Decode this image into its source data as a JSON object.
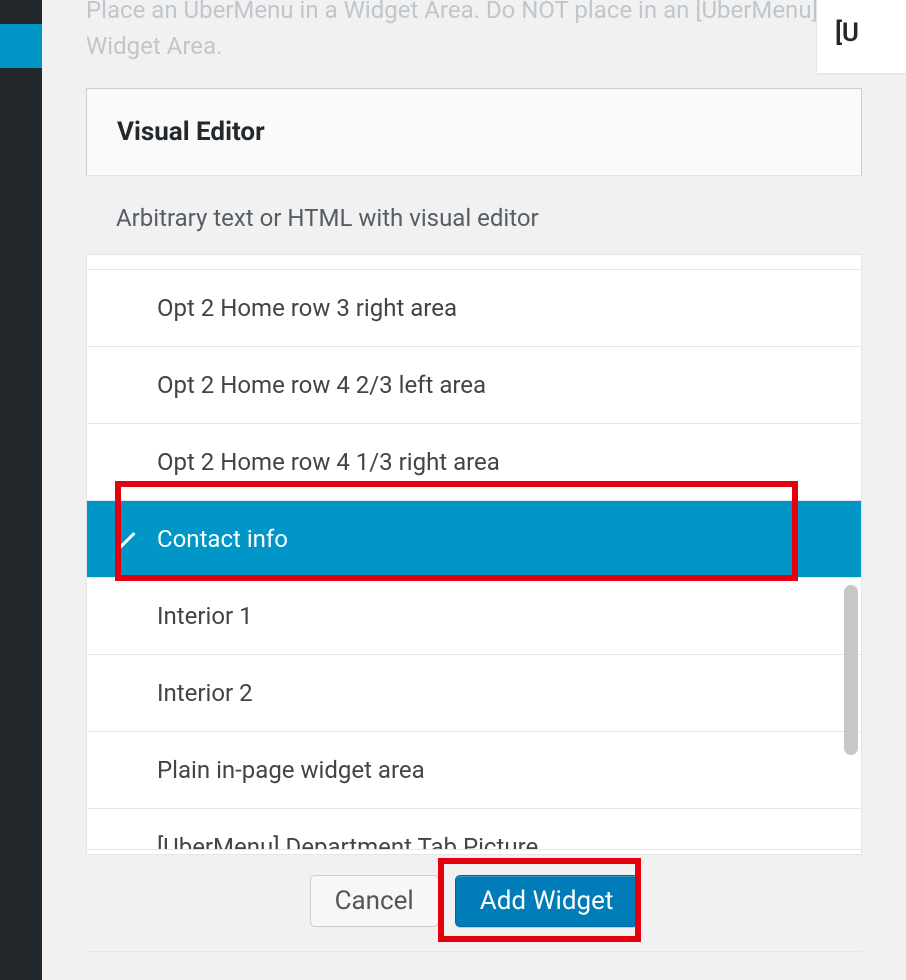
{
  "hint_text": "Place an UberMenu in a Widget Area. Do NOT place in an [UberMenu] Widget Area.",
  "widget": {
    "title": "Visual Editor",
    "description": "Arbitrary text or HTML with visual editor"
  },
  "areas": [
    {
      "label": "Opt 2 Home row 3 right area",
      "selected": false
    },
    {
      "label": "Opt 2 Home row 4 2/3 left area",
      "selected": false
    },
    {
      "label": "Opt 2 Home row 4 1/3 right area",
      "selected": false
    },
    {
      "label": "Contact info",
      "selected": true
    },
    {
      "label": "Interior 1",
      "selected": false
    },
    {
      "label": "Interior 2",
      "selected": false
    },
    {
      "label": "Plain in-page widget area",
      "selected": false
    },
    {
      "label": "[UberMenu] Department Tab Picture",
      "selected": false
    }
  ],
  "buttons": {
    "cancel": "Cancel",
    "add": "Add Widget"
  },
  "side_cards": [
    "[",
    "[U"
  ]
}
